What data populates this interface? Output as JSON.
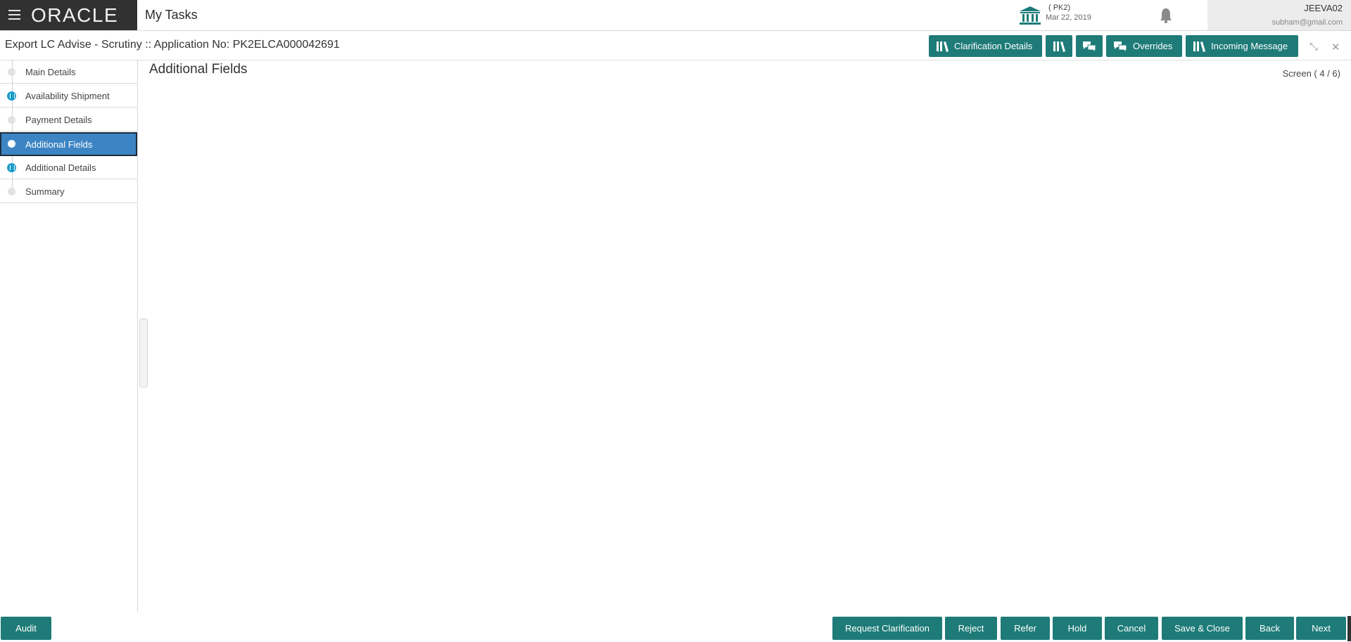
{
  "topbar": {
    "brand": "ORACLE",
    "app_title": "My Tasks",
    "entity_code": "( PK2)",
    "entity_date": "Mar 22, 2019",
    "username": "JEEVA02",
    "user_email": "subham@gmail.com"
  },
  "subheader": {
    "title": "Export LC Advise - Scrutiny :: Application No: PK2ELCA000042691",
    "buttons": {
      "clarification_details": "Clarification Details",
      "overrides": "Overrides",
      "incoming_message": "Incoming Message"
    }
  },
  "sidebar": {
    "steps": [
      {
        "label": "Main Details",
        "status": "pending"
      },
      {
        "label": "Availability Shipment",
        "status": "warning"
      },
      {
        "label": "Payment Details",
        "status": "pending"
      },
      {
        "label": "Additional Fields",
        "status": "active"
      },
      {
        "label": "Additional Details",
        "status": "warning"
      },
      {
        "label": "Summary",
        "status": "pending"
      }
    ]
  },
  "main": {
    "heading": "Additional Fields",
    "screen_indicator": "Screen ( 4 / 6)"
  },
  "footer": {
    "audit": "Audit",
    "request_clarification": "Request Clarification",
    "reject": "Reject",
    "refer": "Refer",
    "hold": "Hold",
    "cancel": "Cancel",
    "save_close": "Save & Close",
    "back": "Back",
    "next": "Next"
  },
  "colors": {
    "brand_bar": "#313131",
    "accent_teal": "#1e7b78",
    "active_step": "#3c84c3",
    "warning_step": "#1b9cc9"
  }
}
